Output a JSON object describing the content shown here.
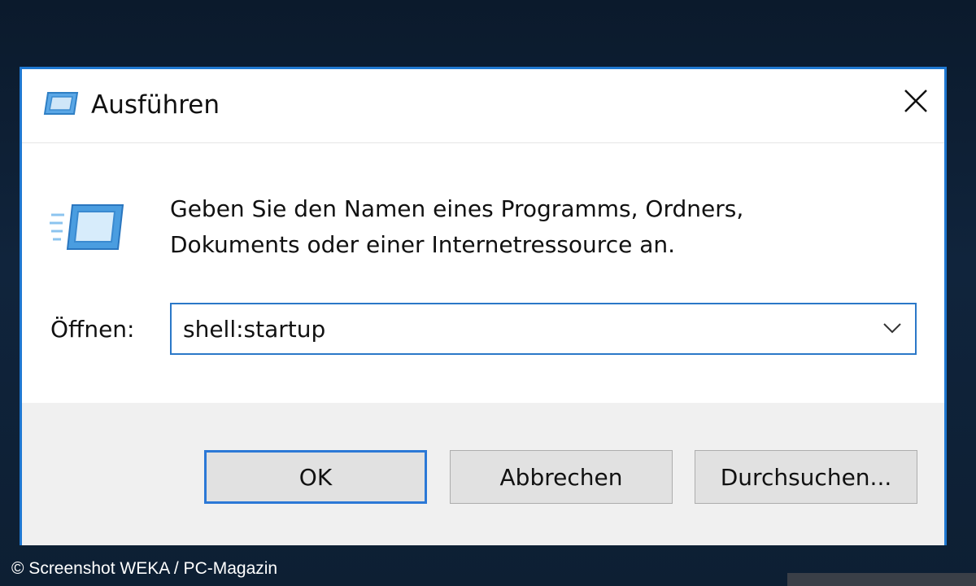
{
  "dialog": {
    "title": "Ausführen",
    "icon": "run-icon",
    "close_icon": "close-icon",
    "description_line1": "Geben Sie den Namen eines Programms, Ordners,",
    "description_line2": "Dokuments oder einer Internetressource an.",
    "open_label": "Öffnen:",
    "open_value": "shell:startup",
    "dropdown_icon": "chevron-down-icon",
    "buttons": {
      "ok": "OK",
      "cancel": "Abbrechen",
      "browse": "Durchsuchen..."
    }
  },
  "credit": "© Screenshot WEKA / PC-Magazin",
  "colors": {
    "accent": "#1f78d1",
    "footer_bg": "#f0f0f0",
    "button_bg": "#e1e1e1"
  }
}
